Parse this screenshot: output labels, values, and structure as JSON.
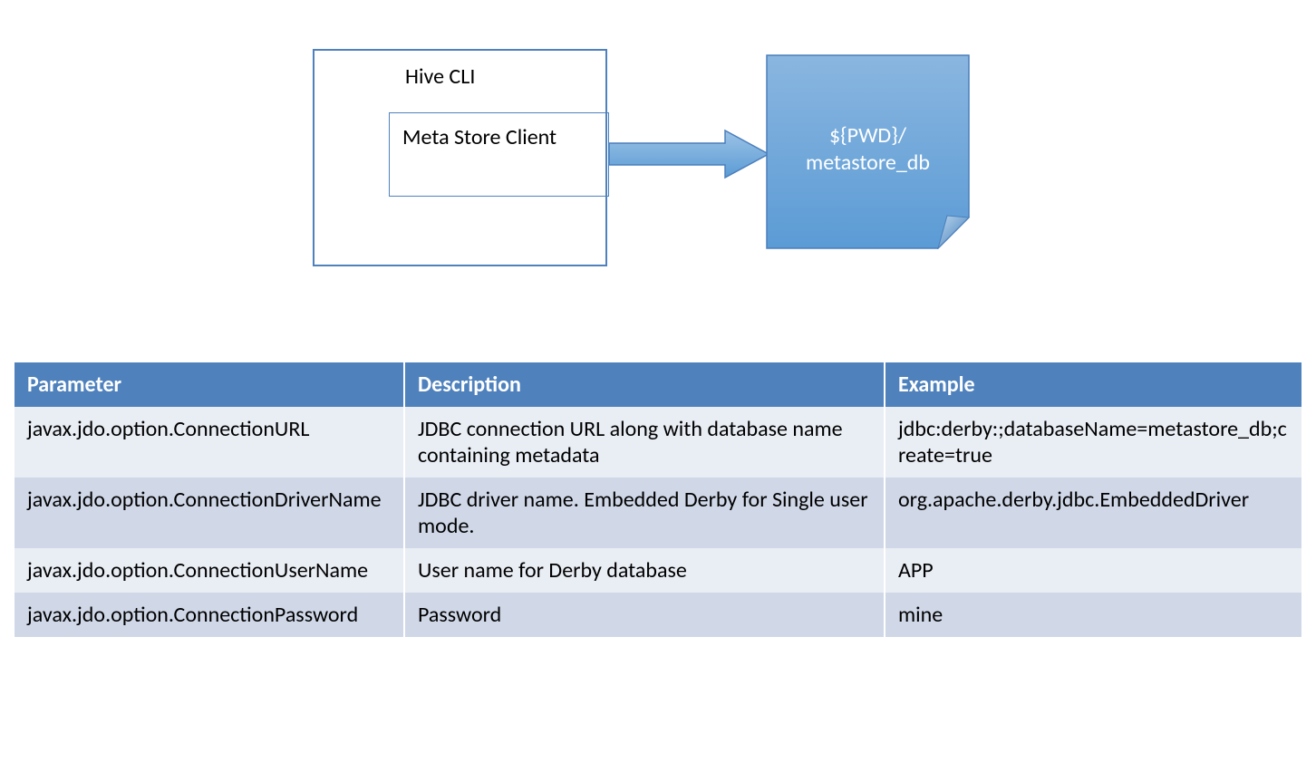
{
  "diagram": {
    "hive_box_title": "Hive CLI",
    "meta_store_client": "Meta Store Client",
    "note_line1": "${PWD}/",
    "note_line2": "metastore_db"
  },
  "table": {
    "headers": {
      "parameter": "Parameter",
      "description": "Description",
      "example": "Example"
    },
    "rows": [
      {
        "parameter": "javax.jdo.option.ConnectionURL",
        "description": "JDBC connection URL along with database name containing metadata",
        "example": "jdbc:derby:;databaseName=metastore_db;create=true"
      },
      {
        "parameter": "javax.jdo.option.ConnectionDriverName",
        "description": "JDBC driver name. Embedded Derby for Single user mode.",
        "example": "org.apache.derby.jdbc.EmbeddedDriver"
      },
      {
        "parameter": "javax.jdo.option.ConnectionUserName",
        "description": "User name for Derby database",
        "example": "APP"
      },
      {
        "parameter": "javax.jdo.option.ConnectionPassword",
        "description": "Password",
        "example": "mine"
      }
    ]
  }
}
